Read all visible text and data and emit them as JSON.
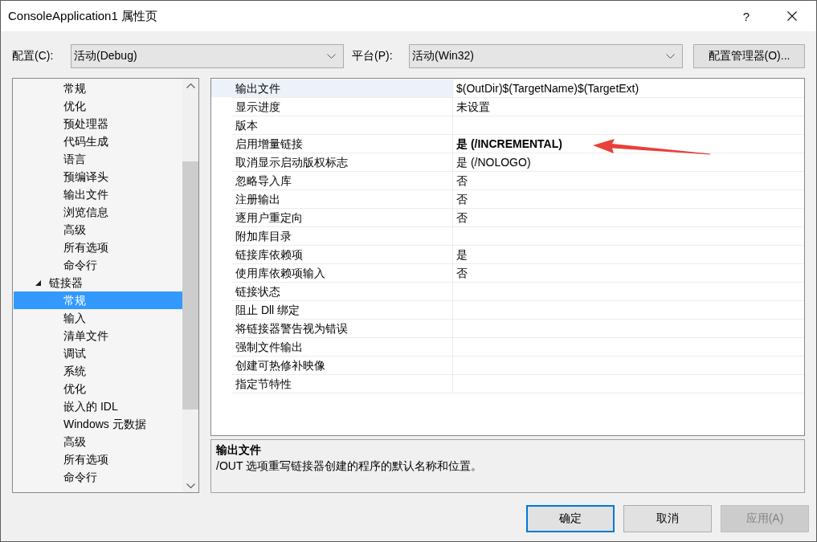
{
  "window": {
    "title": "ConsoleApplication1 属性页",
    "help": "?"
  },
  "config_bar": {
    "configuration": {
      "label": "配置(C):",
      "value": "活动(Debug)"
    },
    "platform": {
      "label": "平台(P):",
      "value": "活动(Win32)"
    },
    "manager_button": "配置管理器(O)..."
  },
  "tree": {
    "items": [
      {
        "children": [
          {
            "label": "常规",
            "selected": false
          },
          {
            "label": "优化",
            "selected": false
          },
          {
            "label": "预处理器",
            "selected": false
          },
          {
            "label": "代码生成",
            "selected": false
          },
          {
            "label": "语言",
            "selected": false
          },
          {
            "label": "预编译头",
            "selected": false
          },
          {
            "label": "输出文件",
            "selected": false
          },
          {
            "label": "浏览信息",
            "selected": false
          },
          {
            "label": "高级",
            "selected": false
          },
          {
            "label": "所有选项",
            "selected": false
          },
          {
            "label": "命令行",
            "selected": false
          }
        ]
      },
      {
        "label": "链接器",
        "expanded": true,
        "selected": false,
        "children": [
          {
            "label": "常规",
            "selected": true
          },
          {
            "label": "输入",
            "selected": false
          },
          {
            "label": "清单文件",
            "selected": false
          },
          {
            "label": "调试",
            "selected": false
          },
          {
            "label": "系统",
            "selected": false
          },
          {
            "label": "优化",
            "selected": false
          },
          {
            "label": "嵌入的 IDL",
            "selected": false
          },
          {
            "label": "Windows 元数据",
            "selected": false
          },
          {
            "label": "高级",
            "selected": false
          },
          {
            "label": "所有选项",
            "selected": false
          },
          {
            "label": "命令行",
            "selected": false
          }
        ]
      }
    ]
  },
  "properties": {
    "rows": [
      {
        "name": "输出文件",
        "value": "$(OutDir)$(TargetName)$(TargetExt)",
        "modified": false,
        "selected": true
      },
      {
        "name": "显示进度",
        "value": "未设置",
        "modified": false,
        "selected": false
      },
      {
        "name": "版本",
        "selected": false
      },
      {
        "name": "启用增量链接",
        "value": "是 (/INCREMENTAL)",
        "modified": true,
        "selected": false,
        "arrow": true
      },
      {
        "name": "取消显示启动版权标志",
        "value": "是 (/NOLOGO)",
        "modified": false,
        "selected": false
      },
      {
        "name": "忽略导入库",
        "value": "否",
        "modified": false,
        "selected": false
      },
      {
        "name": "注册输出",
        "value": "否",
        "modified": false,
        "selected": false
      },
      {
        "name": "逐用户重定向",
        "value": "否",
        "modified": false,
        "selected": false
      },
      {
        "name": "附加库目录",
        "selected": false
      },
      {
        "name": "链接库依赖项",
        "value": "是",
        "modified": false,
        "selected": false
      },
      {
        "name": "使用库依赖项输入",
        "value": "否",
        "modified": false,
        "selected": false
      },
      {
        "name": "链接状态",
        "selected": false
      },
      {
        "name": "阻止 Dll 绑定",
        "selected": false
      },
      {
        "name": "将链接器警告视为错误",
        "selected": false
      },
      {
        "name": "强制文件输出",
        "selected": false
      },
      {
        "name": "创建可热修补映像",
        "selected": false
      },
      {
        "name": "指定节特性",
        "selected": false
      }
    ]
  },
  "description": {
    "title": "输出文件",
    "text": "/OUT 选项重写链接器创建的程序的默认名称和位置。"
  },
  "buttons": [
    {
      "label": "确定",
      "kind": "ok",
      "disabled": false
    },
    {
      "label": "取消",
      "kind": "cancel",
      "disabled": false
    },
    {
      "label": "应用(A)",
      "kind": "apply",
      "disabled": true
    }
  ]
}
